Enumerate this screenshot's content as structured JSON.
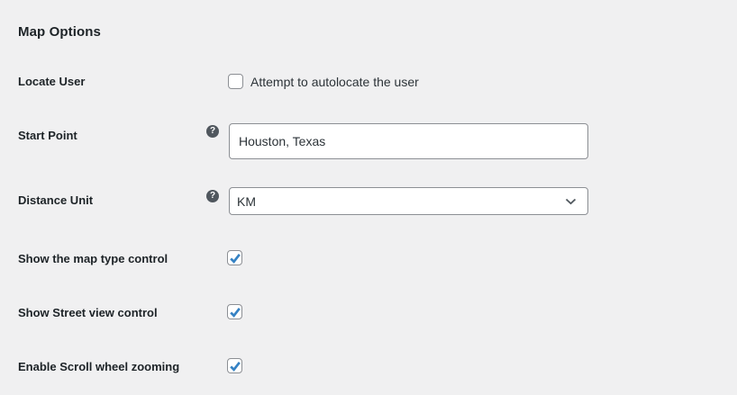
{
  "heading": "Map Options",
  "colors": {
    "background": "#f0f0f1",
    "label_text": "#1d2327",
    "body_text": "#2c3338",
    "control_border": "#8c8f94",
    "checkbox_check": "#3582c4",
    "help_icon_bg": "#50575e"
  },
  "icons": {
    "help_glyph": "?"
  },
  "rows": [
    {
      "id": "locate-user",
      "label": "Locate User",
      "control": "checkbox",
      "checkbox_label": "Attempt to autolocate the user",
      "checked": false
    },
    {
      "id": "start-point",
      "label": "Start Point",
      "control": "text-input",
      "value": "Houston, Texas",
      "has_help": true
    },
    {
      "id": "distance-unit",
      "label": "Distance Unit",
      "control": "select",
      "value": "KM",
      "has_help": true
    },
    {
      "id": "show-map-type-control",
      "label": "Show the map type control",
      "control": "checkbox",
      "checked": true
    },
    {
      "id": "show-street-view-control",
      "label": "Show Street view control",
      "control": "checkbox",
      "checked": true
    },
    {
      "id": "enable-scroll-wheel-zooming",
      "label": "Enable Scroll wheel zooming",
      "control": "checkbox",
      "checked": true
    }
  ]
}
